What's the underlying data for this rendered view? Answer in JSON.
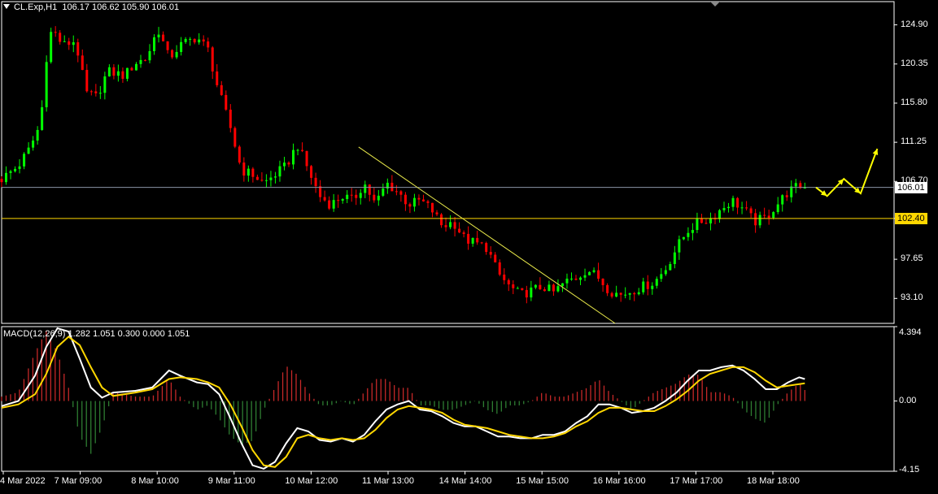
{
  "header": {
    "symbol": "CL.Exp,H1",
    "ohlc": "106.17 106.62 105.90 106.01"
  },
  "macd_label": {
    "title": "MACD(12,26,9)",
    "values": "1.282 1.051 0.300 0.000 1.051"
  },
  "colors": {
    "background": "#000000",
    "bull": "#00ff00",
    "bear": "#ff0000",
    "grid_line": "#8a95a6",
    "level_line": "#ffd700",
    "trend_line": "#e8e84a",
    "macd_main": "#ffffff",
    "macd_signal": "#ffd700",
    "hist_pos": "#c62828",
    "hist_neg": "#2e7d32",
    "arrow": "#ffff00"
  },
  "chart_data": [
    {
      "type": "candlestick",
      "symbol": "CL.Exp",
      "timeframe": "H1",
      "y_ticks": [
        124.9,
        120.35,
        115.8,
        111.25,
        106.7,
        102.4,
        97.65,
        93.1
      ],
      "y_tick_labels": [
        "124.90",
        "120.35",
        "115.80",
        "111.25",
        "106.70",
        "102.40",
        "97.65",
        "93.10"
      ],
      "ylim": [
        90.2,
        127.6
      ],
      "x_tick_labels": [
        "4 Mar 2022",
        "7 Mar 09:00",
        "8 Mar 10:00",
        "9 Mar 11:00",
        "10 Mar 12:00",
        "11 Mar 13:00",
        "14 Mar 14:00",
        "15 Mar 15:00",
        "16 Mar 16:00",
        "17 Mar 17:00",
        "18 Mar 18:00"
      ],
      "close_path": [
        [
          0,
          107.0
        ],
        [
          3,
          108.5
        ],
        [
          5,
          110.5
        ],
        [
          7,
          113.5
        ],
        [
          8,
          121.0
        ],
        [
          9,
          124.5
        ],
        [
          11,
          122.5
        ],
        [
          13,
          123.0
        ],
        [
          14,
          121.0
        ],
        [
          15,
          117.0
        ],
        [
          17,
          116.5
        ],
        [
          19,
          119.5
        ],
        [
          22,
          119.0
        ],
        [
          24,
          120.5
        ],
        [
          26,
          121.0
        ],
        [
          28,
          124.5
        ],
        [
          30,
          121.0
        ],
        [
          32,
          122.5
        ],
        [
          35,
          123.5
        ],
        [
          37,
          122.0
        ],
        [
          39,
          117.0
        ],
        [
          41,
          113.0
        ],
        [
          43,
          108.0
        ],
        [
          45,
          107.5
        ],
        [
          47,
          106.5
        ],
        [
          49,
          107.5
        ],
        [
          51,
          108.5
        ],
        [
          53,
          111.0
        ],
        [
          55,
          108.0
        ],
        [
          57,
          105.0
        ],
        [
          59,
          104.0
        ],
        [
          61,
          105.0
        ],
        [
          63,
          104.5
        ],
        [
          65,
          106.5
        ],
        [
          67,
          104.0
        ],
        [
          69,
          106.5
        ],
        [
          71,
          105.5
        ],
        [
          73,
          104.0
        ],
        [
          75,
          104.5
        ],
        [
          77,
          103.5
        ],
        [
          79,
          101.5
        ],
        [
          81,
          102.0
        ],
        [
          83,
          100.0
        ],
        [
          85,
          99.5
        ],
        [
          87,
          99.0
        ],
        [
          89,
          96.0
        ],
        [
          91,
          94.5
        ],
        [
          93,
          93.5
        ],
        [
          95,
          94.0
        ],
        [
          97,
          94.5
        ],
        [
          99,
          93.8
        ],
        [
          101,
          95.0
        ],
        [
          103,
          95.5
        ],
        [
          105,
          96.5
        ],
        [
          107,
          95.5
        ],
        [
          109,
          94.0
        ],
        [
          111,
          93.5
        ],
        [
          113,
          94.0
        ],
        [
          115,
          94.5
        ],
        [
          117,
          95.0
        ],
        [
          119,
          96.5
        ],
        [
          121,
          99.0
        ],
        [
          123,
          101.0
        ],
        [
          125,
          102.0
        ],
        [
          127,
          102.3
        ],
        [
          129,
          103.5
        ],
        [
          131,
          104.5
        ],
        [
          133,
          103.5
        ],
        [
          135,
          102.0
        ],
        [
          137,
          102.5
        ],
        [
          139,
          104.0
        ],
        [
          141,
          105.5
        ],
        [
          143,
          106.2
        ],
        [
          144,
          106.0
        ]
      ],
      "horizontal_levels": [
        106.01,
        102.4
      ],
      "level_labels": [
        "106.01",
        "102.40"
      ],
      "trendline": {
        "from": [
          64,
          110.7
        ],
        "to": [
          110,
          90.2
        ]
      },
      "forecast_arrows": [
        [
          146,
          106.0
        ],
        [
          148,
          105.0
        ],
        [
          151,
          107.0
        ],
        [
          154,
          105.3
        ],
        [
          157,
          110.5
        ]
      ]
    },
    {
      "type": "line",
      "name": "MACD(12,26,9)",
      "y_ticks": [
        4.394,
        0.0,
        -4.15
      ],
      "y_tick_labels": [
        "4.394",
        "0.00",
        "-4.15"
      ],
      "ylim": [
        -4.15,
        4.394
      ],
      "macd_main": [
        [
          0,
          -0.3
        ],
        [
          3,
          0.0
        ],
        [
          6,
          1.5
        ],
        [
          8,
          3.2
        ],
        [
          10,
          4.3
        ],
        [
          12,
          4.1
        ],
        [
          14,
          2.5
        ],
        [
          16,
          0.8
        ],
        [
          18,
          0.2
        ],
        [
          20,
          0.5
        ],
        [
          24,
          0.6
        ],
        [
          27,
          0.8
        ],
        [
          30,
          1.8
        ],
        [
          32,
          1.5
        ],
        [
          35,
          1.1
        ],
        [
          37,
          1.0
        ],
        [
          39,
          0.4
        ],
        [
          41,
          -1.0
        ],
        [
          43,
          -2.5
        ],
        [
          45,
          -3.8
        ],
        [
          47,
          -4.0
        ],
        [
          49,
          -3.6
        ],
        [
          51,
          -2.5
        ],
        [
          53,
          -1.6
        ],
        [
          55,
          -1.8
        ],
        [
          57,
          -2.3
        ],
        [
          59,
          -2.4
        ],
        [
          61,
          -2.2
        ],
        [
          63,
          -2.4
        ],
        [
          65,
          -2.0
        ],
        [
          67,
          -1.2
        ],
        [
          69,
          -0.5
        ],
        [
          71,
          -0.2
        ],
        [
          73,
          0.0
        ],
        [
          75,
          -0.5
        ],
        [
          77,
          -0.6
        ],
        [
          79,
          -0.9
        ],
        [
          81,
          -1.3
        ],
        [
          83,
          -1.5
        ],
        [
          85,
          -1.5
        ],
        [
          87,
          -1.8
        ],
        [
          89,
          -2.1
        ],
        [
          91,
          -2.1
        ],
        [
          93,
          -2.2
        ],
        [
          95,
          -2.2
        ],
        [
          97,
          -2.0
        ],
        [
          99,
          -2.0
        ],
        [
          101,
          -1.8
        ],
        [
          103,
          -1.3
        ],
        [
          105,
          -0.9
        ],
        [
          107,
          -0.2
        ],
        [
          109,
          -0.2
        ],
        [
          111,
          -0.4
        ],
        [
          113,
          -0.7
        ],
        [
          115,
          -0.6
        ],
        [
          117,
          -0.4
        ],
        [
          119,
          0.0
        ],
        [
          121,
          0.5
        ],
        [
          123,
          1.2
        ],
        [
          125,
          1.8
        ],
        [
          127,
          1.8
        ],
        [
          129,
          2.0
        ],
        [
          131,
          2.1
        ],
        [
          133,
          1.8
        ],
        [
          135,
          1.3
        ],
        [
          137,
          0.7
        ],
        [
          139,
          0.7
        ],
        [
          141,
          1.1
        ],
        [
          143,
          1.4
        ],
        [
          144,
          1.3
        ]
      ],
      "macd_signal": [
        [
          0,
          -0.4
        ],
        [
          3,
          -0.2
        ],
        [
          6,
          0.4
        ],
        [
          8,
          1.6
        ],
        [
          10,
          3.2
        ],
        [
          12,
          3.8
        ],
        [
          14,
          3.3
        ],
        [
          16,
          2.0
        ],
        [
          18,
          0.8
        ],
        [
          20,
          0.3
        ],
        [
          24,
          0.5
        ],
        [
          27,
          0.7
        ],
        [
          30,
          1.3
        ],
        [
          32,
          1.4
        ],
        [
          35,
          1.3
        ],
        [
          37,
          1.1
        ],
        [
          39,
          0.8
        ],
        [
          41,
          -0.2
        ],
        [
          43,
          -1.5
        ],
        [
          45,
          -2.9
        ],
        [
          47,
          -3.8
        ],
        [
          49,
          -3.9
        ],
        [
          51,
          -3.3
        ],
        [
          53,
          -2.2
        ],
        [
          55,
          -2.0
        ],
        [
          57,
          -2.2
        ],
        [
          59,
          -2.3
        ],
        [
          61,
          -2.2
        ],
        [
          63,
          -2.3
        ],
        [
          65,
          -2.2
        ],
        [
          67,
          -1.7
        ],
        [
          69,
          -1.0
        ],
        [
          71,
          -0.5
        ],
        [
          73,
          -0.3
        ],
        [
          75,
          -0.4
        ],
        [
          77,
          -0.5
        ],
        [
          79,
          -0.7
        ],
        [
          81,
          -1.1
        ],
        [
          83,
          -1.4
        ],
        [
          85,
          -1.5
        ],
        [
          87,
          -1.6
        ],
        [
          89,
          -1.8
        ],
        [
          91,
          -2.0
        ],
        [
          93,
          -2.1
        ],
        [
          95,
          -2.2
        ],
        [
          97,
          -2.2
        ],
        [
          99,
          -2.1
        ],
        [
          101,
          -1.9
        ],
        [
          103,
          -1.5
        ],
        [
          105,
          -1.2
        ],
        [
          107,
          -0.7
        ],
        [
          109,
          -0.4
        ],
        [
          111,
          -0.4
        ],
        [
          113,
          -0.5
        ],
        [
          115,
          -0.6
        ],
        [
          117,
          -0.6
        ],
        [
          119,
          -0.3
        ],
        [
          121,
          0.1
        ],
        [
          123,
          0.6
        ],
        [
          125,
          1.2
        ],
        [
          127,
          1.6
        ],
        [
          129,
          1.8
        ],
        [
          131,
          2.0
        ],
        [
          133,
          2.0
        ],
        [
          135,
          1.7
        ],
        [
          137,
          1.2
        ],
        [
          139,
          0.8
        ],
        [
          141,
          0.9
        ],
        [
          143,
          1.0
        ],
        [
          144,
          1.05
        ]
      ]
    }
  ]
}
